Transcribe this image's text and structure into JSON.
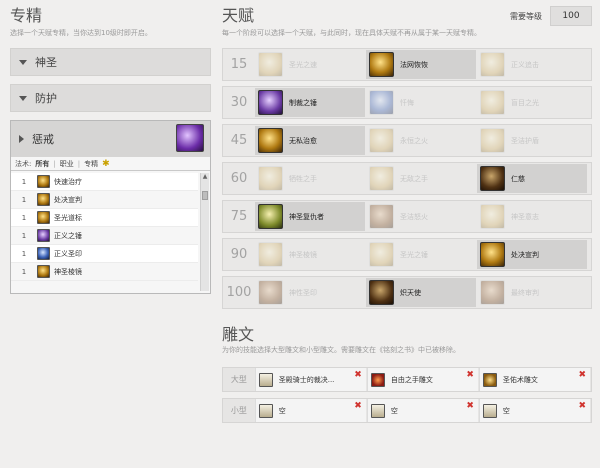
{
  "spec": {
    "title": "专精",
    "subtitle": "选择一个天赋专精，当你达到10级时即开启。",
    "collapsed": [
      {
        "name": "神圣"
      },
      {
        "name": "防护"
      }
    ],
    "expanded": {
      "name": "惩戒",
      "filter": {
        "label": "法术:",
        "options": [
          "所有",
          "职业",
          "专精"
        ],
        "active": "所有",
        "star": "✱"
      },
      "spells": [
        {
          "level": "1",
          "name": "快速治疗",
          "icon": "i-gold"
        },
        {
          "level": "1",
          "name": "处决宣判",
          "icon": "i-gold"
        },
        {
          "level": "1",
          "name": "圣光道标",
          "icon": "i-gold"
        },
        {
          "level": "1",
          "name": "正义之锤",
          "icon": "i-violet"
        },
        {
          "level": "1",
          "name": "正义圣印",
          "icon": "i-blue"
        },
        {
          "level": "1",
          "name": "神圣棱镜",
          "icon": "i-gold"
        }
      ]
    }
  },
  "talents": {
    "title": "天赋",
    "subtitle": "每一个阶段可以选择一个天赋，与此同时，现在具体天赋不再从属于某一天赋专精。",
    "req_label": "需要等级",
    "req_value": "100",
    "tiers": [
      {
        "level": "15",
        "cells": [
          {
            "name": "圣光之速",
            "icon": "i-light",
            "selected": false
          },
          {
            "name": "法网恢恢",
            "icon": "i-gold",
            "selected": true
          },
          {
            "name": "正义追击",
            "icon": "i-light",
            "selected": false
          }
        ]
      },
      {
        "level": "30",
        "cells": [
          {
            "name": "制裁之锤",
            "icon": "i-violet",
            "selected": true
          },
          {
            "name": "忏悔",
            "icon": "i-blue",
            "selected": false
          },
          {
            "name": "盲目之光",
            "icon": "i-light",
            "selected": false
          }
        ]
      },
      {
        "level": "45",
        "cells": [
          {
            "name": "无私治愈",
            "icon": "i-gold",
            "selected": true
          },
          {
            "name": "永恒之火",
            "icon": "i-light",
            "selected": false
          },
          {
            "name": "圣洁护盾",
            "icon": "i-light",
            "selected": false
          }
        ]
      },
      {
        "level": "60",
        "cells": [
          {
            "name": "牺牲之手",
            "icon": "i-light",
            "selected": false
          },
          {
            "name": "无敌之手",
            "icon": "i-light",
            "selected": false
          },
          {
            "name": "仁慈",
            "icon": "i-dark",
            "selected": true
          }
        ]
      },
      {
        "level": "75",
        "cells": [
          {
            "name": "神圣复仇者",
            "icon": "i-green",
            "selected": true
          },
          {
            "name": "圣洁怒火",
            "icon": "i-brown",
            "selected": false
          },
          {
            "name": "神圣意志",
            "icon": "i-light",
            "selected": false
          }
        ]
      },
      {
        "level": "90",
        "cells": [
          {
            "name": "神圣棱镜",
            "icon": "i-light",
            "selected": false
          },
          {
            "name": "圣光之锤",
            "icon": "i-light",
            "selected": false
          },
          {
            "name": "处决宣判",
            "icon": "i-gold",
            "selected": true
          }
        ]
      },
      {
        "level": "100",
        "cells": [
          {
            "name": "神性圣印",
            "icon": "i-brown",
            "selected": false
          },
          {
            "name": "炽天使",
            "icon": "i-dark",
            "selected": true
          },
          {
            "name": "最终审判",
            "icon": "i-brown",
            "selected": false
          }
        ]
      }
    ]
  },
  "glyphs": {
    "title": "雕文",
    "subtitle": "为你的技能选择大型雕文和小型雕文。需要雕文在《铭刻之书》中已被移除。",
    "major_label": "大型",
    "minor_label": "小型",
    "remove_symbol": "✖",
    "major": [
      {
        "name": "圣殿骑士的裁决...",
        "icon": "gicon-scroll"
      },
      {
        "name": "自由之手雕文",
        "icon": "gicon-red"
      },
      {
        "name": "圣佑术雕文",
        "icon": "gicon-gold"
      }
    ],
    "minor": [
      {
        "name": "空",
        "icon": "gicon-scroll"
      },
      {
        "name": "空",
        "icon": "gicon-scroll"
      },
      {
        "name": "空",
        "icon": "gicon-scroll"
      }
    ]
  }
}
